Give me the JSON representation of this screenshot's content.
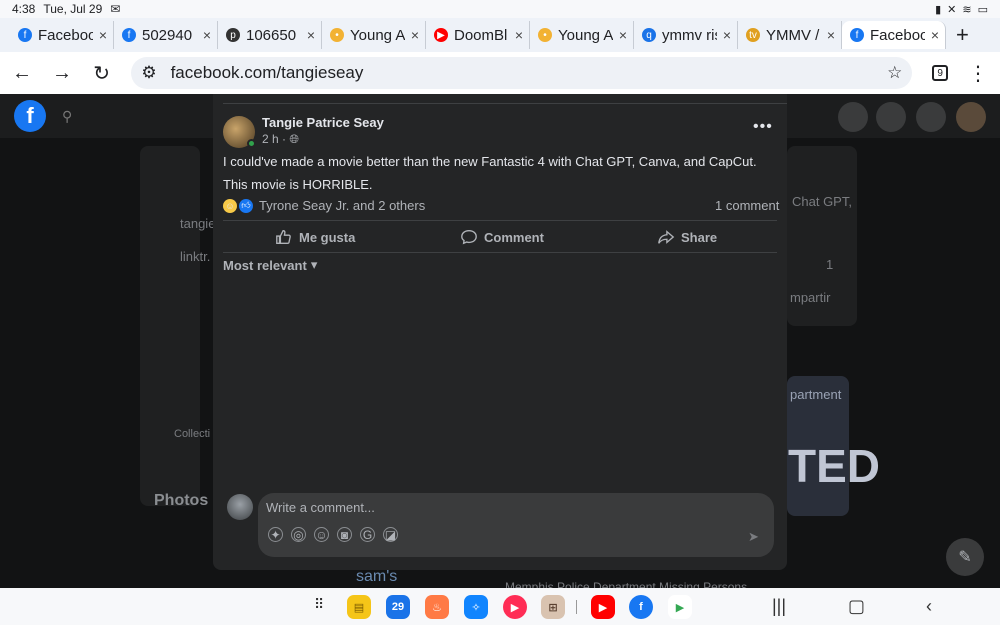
{
  "status_bar": {
    "time": "4:38",
    "date": "Tue, Jul 29",
    "left_icon": "gmail-icon",
    "right_icons": [
      "battery-icon",
      "mute-icon",
      "wifi-icon",
      "battery-level-icon"
    ]
  },
  "tabs": [
    {
      "label": "Faceboo",
      "icon": "facebook-icon",
      "icon_color": "#1877f2",
      "glyph": "f"
    },
    {
      "label": "502940",
      "icon": "facebook-icon",
      "icon_color": "#1877f2",
      "glyph": "f"
    },
    {
      "label": "106650",
      "icon": "pinterest-icon",
      "icon_color": "#333333",
      "glyph": "p"
    },
    {
      "label": "Young A",
      "icon": "bulb-icon",
      "icon_color": "#f2b233",
      "glyph": "•"
    },
    {
      "label": "DoomBl",
      "icon": "youtube-icon",
      "icon_color": "#ff0000",
      "glyph": "▶"
    },
    {
      "label": "Young A",
      "icon": "bulb-icon",
      "icon_color": "#f2b233",
      "glyph": "•"
    },
    {
      "label": "ymmv ris",
      "icon": "search-icon",
      "icon_color": "#1a73e8",
      "glyph": "q"
    },
    {
      "label": "YMMV /",
      "icon": "tvtropes-icon",
      "icon_color": "#e0a020",
      "glyph": "tv"
    },
    {
      "label": "Faceboo",
      "icon": "facebook-icon",
      "icon_color": "#1877f2",
      "glyph": "f",
      "active": true
    }
  ],
  "tab_close_glyph": "×",
  "new_tab_glyph": "+",
  "address_bar": {
    "url": "facebook.com/tangieseay",
    "tab_count": "9"
  },
  "background_page": {
    "snippet_chat": "Chat GPT,",
    "snippet_compartir": "mpartir",
    "snippet_count": "1",
    "snippet_department": "partment",
    "snippet_collections": "Collecti",
    "snippet_linktr": "linktr.",
    "snippet_tangie": "tangie",
    "photos_heading": "Photos",
    "snippet_sams": "sam's",
    "snippet_ted": "TED",
    "snippet_memphis": "Memphis Police Department Missing Persons"
  },
  "post": {
    "author": "Tangie Patrice Seay",
    "time": "2 h",
    "line1": "I could've made a movie better than the new Fantastic 4 with Chat GPT, Canva, and CapCut.",
    "line2": "This movie is HORRIBLE.",
    "reaction_names": "Tyrone Seay Jr. and 2 others",
    "comment_count": "1 comment",
    "actions": {
      "like": "Me gusta",
      "comment": "Comment",
      "share": "Share"
    },
    "sort_label": "Most relevant",
    "composer_placeholder": "Write a comment..."
  },
  "dock": {
    "calendar_day": "29"
  },
  "colors": {
    "facebook_blue": "#1877f2",
    "modal_bg": "#242526",
    "online_green": "#31a24c"
  }
}
